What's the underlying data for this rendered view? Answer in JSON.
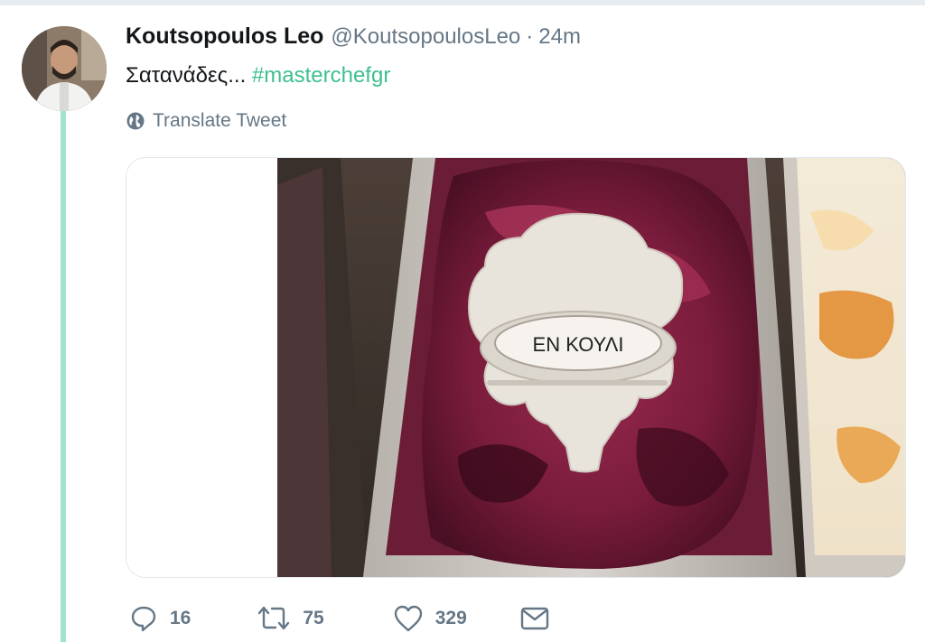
{
  "tweet": {
    "author_name": "Koutsopoulos Leo",
    "handle": "@KoutsopoulosLeo",
    "separator": "·",
    "timestamp": "24m",
    "text": "Σατανάδες...",
    "hashtag": "#masterchefgr",
    "translate_label": "Translate Tweet",
    "sign_text": "ΕΝ ΚΟΥΛΙ"
  },
  "actions": {
    "reply_count": "16",
    "retweet_count": "75",
    "like_count": "329"
  },
  "icons": {
    "translate": "globe-icon",
    "reply": "reply-icon",
    "retweet": "retweet-icon",
    "like": "heart-icon",
    "message": "envelope-icon"
  },
  "colors": {
    "hashtag": "#3ebf8f",
    "thread_line": "#a3e3cd",
    "secondary_text": "#657786"
  }
}
